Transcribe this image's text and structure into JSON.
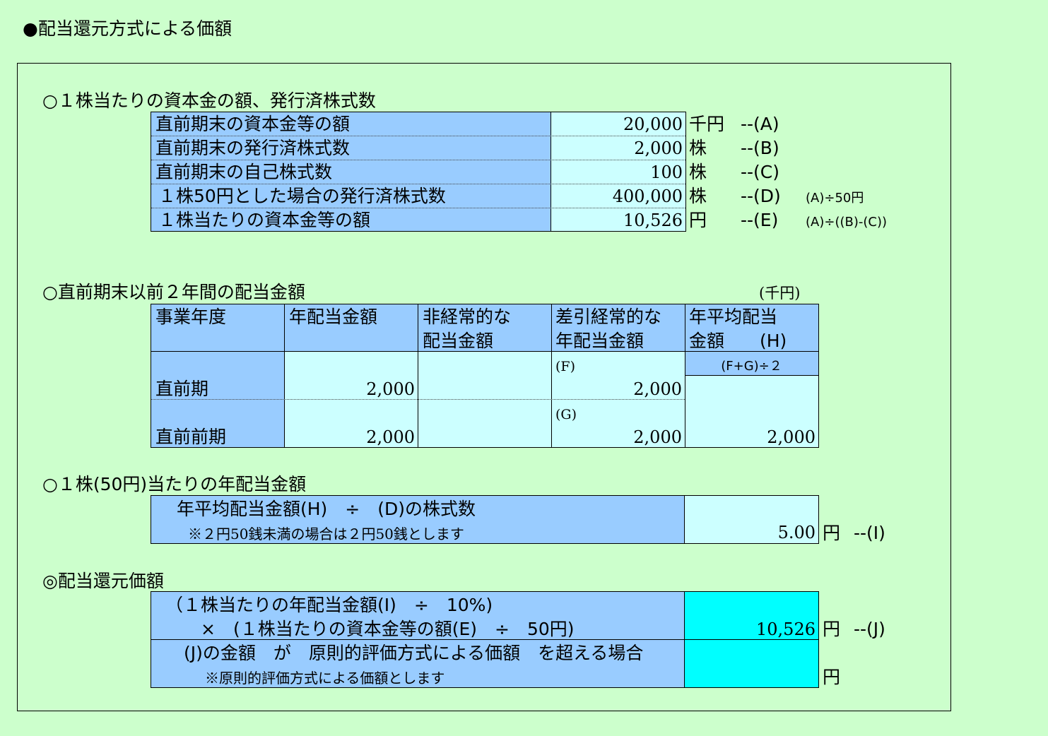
{
  "page_title": "●配当還元方式による価額",
  "s1": {
    "heading": "○１株当たりの資本金の額、発行済株式数",
    "rows": [
      {
        "label": "直前期末の資本金等の額",
        "value": "20,000",
        "unit": "千円",
        "code": "--(A)",
        "formula": ""
      },
      {
        "label": "直前期末の発行済株式数",
        "value": "2,000",
        "unit": "株",
        "code": "--(B)",
        "formula": ""
      },
      {
        "label": "直前期末の自己株式数",
        "value": "100",
        "unit": "株",
        "code": "--(C)",
        "formula": ""
      },
      {
        "label": "１株50円とした場合の発行済株式数",
        "value": "400,000",
        "unit": "株",
        "code": "--(D)",
        "formula": "(A)÷50円"
      },
      {
        "label": "１株当たりの資本金等の額",
        "value": "10,526",
        "unit": "円",
        "code": "--(E)",
        "formula": "(A)÷((B)-(C))"
      }
    ]
  },
  "s2": {
    "heading": "○直前期末以前２年間の配当金額",
    "unit_note": "(千円)",
    "headers": {
      "year": "事業年度",
      "annual": "年配当金額",
      "extra_1": "非経常的な",
      "extra_2": "配当金額",
      "net_1": "差引経常的な",
      "net_2": "年配当金額",
      "avg_1": "年平均配当",
      "avg_2": "金額　　(H)",
      "avg_formula": "(F+G)÷２"
    },
    "rows": [
      {
        "year": "直前期",
        "annual": "2,000",
        "extra": "",
        "net_tag": "(F)",
        "net": "2,000"
      },
      {
        "year": "直前前期",
        "annual": "2,000",
        "extra": "",
        "net_tag": "(G)",
        "net": "2,000"
      }
    ],
    "average": "2,000"
  },
  "s3": {
    "heading": "○１株(50円)当たりの年配当金額",
    "label": "年平均配当金額(H)　÷　(D)の株式数",
    "note": "※２円50銭未満の場合は２円50銭とします",
    "value": "5.00",
    "unit": "円",
    "code": "--(I)"
  },
  "s4": {
    "heading": "◎配当還元価額",
    "label_1": "（１株当たりの年配当金額(I)　÷　10%)",
    "label_2": "×　(１株当たりの資本金等の額(E)　÷　50円)",
    "value": "10,526",
    "unit": "円",
    "code": "--(J)",
    "label_3": "(J)の金額　が　原則的評価方式による価額　を超える場合",
    "note": "※原則的評価方式による価額とします",
    "value2": "",
    "unit2": "円"
  }
}
